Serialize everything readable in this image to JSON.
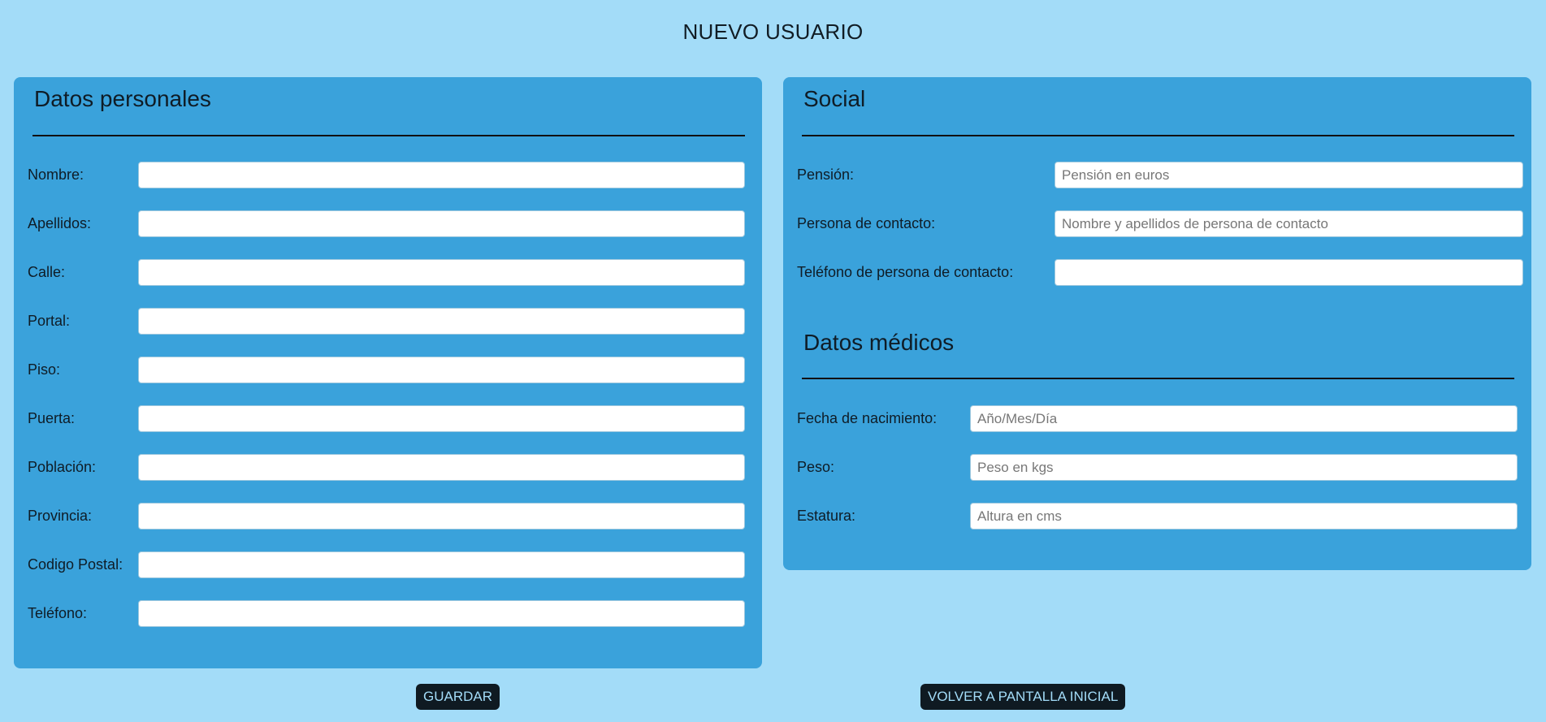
{
  "title": "NUEVO USUARIO",
  "personal": {
    "heading": "Datos personales",
    "fields": [
      {
        "label": "Nombre:",
        "value": "",
        "placeholder": ""
      },
      {
        "label": "Apellidos:",
        "value": "",
        "placeholder": ""
      },
      {
        "label": "Calle:",
        "value": "",
        "placeholder": ""
      },
      {
        "label": "Portal:",
        "value": "",
        "placeholder": ""
      },
      {
        "label": "Piso:",
        "value": "",
        "placeholder": ""
      },
      {
        "label": "Puerta:",
        "value": "",
        "placeholder": ""
      },
      {
        "label": "Población:",
        "value": "",
        "placeholder": ""
      },
      {
        "label": "Provincia:",
        "value": "",
        "placeholder": ""
      },
      {
        "label": "Codigo Postal:",
        "value": "",
        "placeholder": ""
      },
      {
        "label": "Teléfono:",
        "value": "",
        "placeholder": ""
      }
    ]
  },
  "social": {
    "heading": "Social",
    "fields": [
      {
        "label": "Pensión:",
        "value": "",
        "placeholder": "Pensión en euros"
      },
      {
        "label": "Persona de contacto:",
        "value": "",
        "placeholder": "Nombre y apellidos de persona de contacto"
      },
      {
        "label": "Teléfono de persona de contacto:",
        "value": "",
        "placeholder": ""
      }
    ]
  },
  "medical": {
    "heading": "Datos médicos",
    "fields": [
      {
        "label": "Fecha de nacimiento:",
        "value": "",
        "placeholder": "Año/Mes/Día"
      },
      {
        "label": "Peso:",
        "value": "",
        "placeholder": "Peso en kgs"
      },
      {
        "label": "Estatura:",
        "value": "",
        "placeholder": "Altura en cms"
      }
    ]
  },
  "buttons": {
    "save": "GUARDAR",
    "back": "VOLVER A PANTALLA INICIAL"
  },
  "colors": {
    "background": "#a3dcf8",
    "panel": "#3aa2db",
    "button_bg": "#0f1a22",
    "button_text": "#a3dcf8"
  }
}
